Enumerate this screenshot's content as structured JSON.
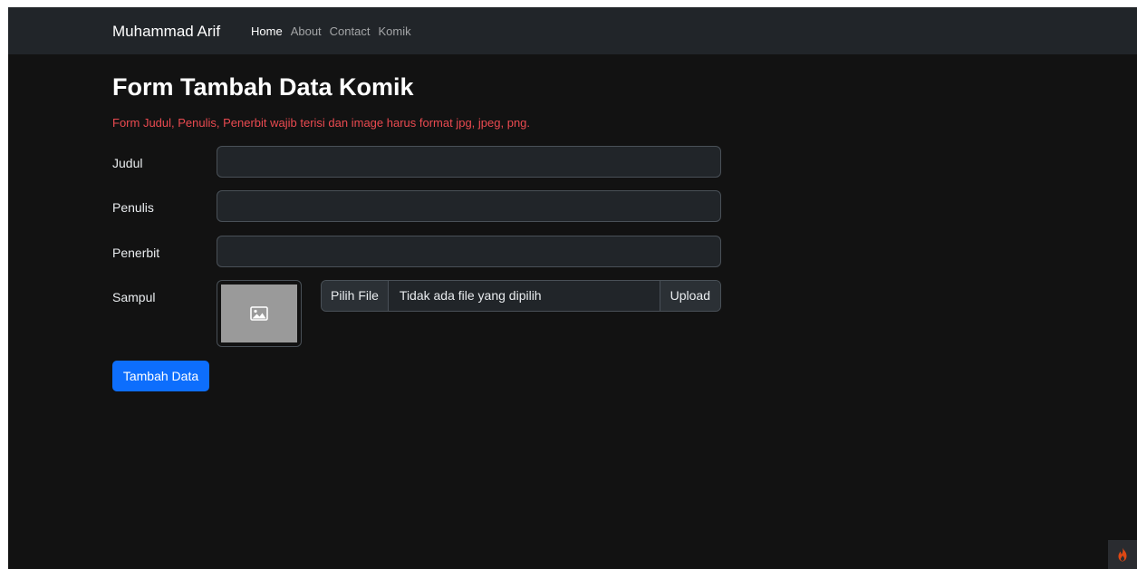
{
  "navbar": {
    "brand": "Muhammad Arif",
    "links": [
      "Home",
      "About",
      "Contact",
      "Komik"
    ]
  },
  "page": {
    "title": "Form Tambah Data Komik",
    "alert": "Form Judul, Penulis, Penerbit wajib terisi dan image harus format jpg, jpeg, png."
  },
  "form": {
    "judul": {
      "label": "Judul",
      "value": ""
    },
    "penulis": {
      "label": "Penulis",
      "value": ""
    },
    "penerbit": {
      "label": "Penerbit",
      "value": ""
    },
    "sampul": {
      "label": "Sampul",
      "choose_label": "Pilih File",
      "file_name": "Tidak ada file yang dipilih",
      "upload_label": "Upload",
      "preview_icon": "image-placeholder-icon"
    },
    "submit_label": "Tambah Data"
  },
  "debug_toolbar": {
    "icon": "flame-icon",
    "color": "#dd4814"
  },
  "colors": {
    "background": "#121212",
    "navbar": "#212529",
    "alert_text": "#ea4a50",
    "primary": "#0d6efd"
  }
}
